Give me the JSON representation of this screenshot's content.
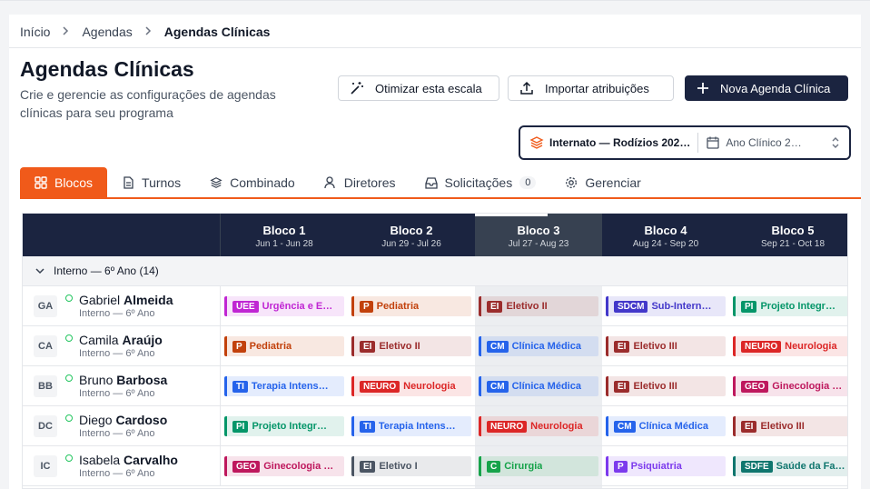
{
  "breadcrumb": [
    "Início",
    "Agendas",
    "Agendas Clínicas"
  ],
  "page": {
    "title": "Agendas Clínicas",
    "subtitle": "Crie e gerencie as configurações de agendas clínicas para seu programa"
  },
  "actions": {
    "optimize": "Otimizar esta escala",
    "import": "Importar atribuições",
    "new": "Nova Agenda Clínica"
  },
  "selector": {
    "program": "Internato — Rodízios 202…",
    "year": "Ano Clínico 2…"
  },
  "tabs": [
    {
      "label": "Blocos",
      "active": true,
      "icon": "blocks-icon"
    },
    {
      "label": "Turnos",
      "icon": "document-icon"
    },
    {
      "label": "Combinado",
      "icon": "layers-icon"
    },
    {
      "label": "Diretores",
      "icon": "user-icon"
    },
    {
      "label": "Solicitações",
      "badge": "0",
      "icon": "inbox-icon"
    },
    {
      "label": "Gerenciar",
      "icon": "gear-icon"
    }
  ],
  "blocos": [
    {
      "name": "Bloco 1",
      "dates": "Jun 1 - Jun 28"
    },
    {
      "name": "Bloco 2",
      "dates": "Jun 29 - Jul 26"
    },
    {
      "name": "Bloco 3",
      "dates": "Jul 27 - Aug 23",
      "current": true
    },
    {
      "name": "Bloco 4",
      "dates": "Aug 24 - Sep 20"
    },
    {
      "name": "Bloco 5",
      "dates": "Sep 21 - Oct 18"
    }
  ],
  "group": {
    "label": "Interno — 6º Ano (14)"
  },
  "colors": {
    "UEE": "#c026d3",
    "P": "#c2410c",
    "EI": "#9b2c2c",
    "SDCM": "#4338ca",
    "PI": "#059669",
    "CM": "#2563eb",
    "TI": "#2563eb",
    "NEURO": "#dc2626",
    "GEO": "#be185d",
    "C": "#16a34a",
    "SDFE": "#0f766e"
  },
  "rows": [
    {
      "initials": "GA",
      "first": "Gabriel",
      "last": "Almeida",
      "role": "Interno — 6º Ano",
      "cells": [
        {
          "code": "UEE",
          "label": "Urgência e E…"
        },
        {
          "code": "P",
          "label": "Pediatria"
        },
        {
          "code": "EI",
          "label": "Eletivo II"
        },
        {
          "code": "SDCM",
          "label": "Sub-Intern…"
        },
        {
          "code": "PI",
          "label": "Projeto Integr…"
        }
      ]
    },
    {
      "initials": "CA",
      "first": "Camila",
      "last": "Araújo",
      "role": "Interno — 6º Ano",
      "cells": [
        {
          "code": "P",
          "label": "Pediatria"
        },
        {
          "code": "EI",
          "label": "Eletivo II"
        },
        {
          "code": "CM",
          "label": "Clínica Médica"
        },
        {
          "code": "EI",
          "label": "Eletivo III"
        },
        {
          "code": "NEURO",
          "label": "Neurologia"
        }
      ]
    },
    {
      "initials": "BB",
      "first": "Bruno",
      "last": "Barbosa",
      "role": "Interno — 6º Ano",
      "cells": [
        {
          "code": "TI",
          "label": "Terapia Intens…"
        },
        {
          "code": "NEURO",
          "label": "Neurologia"
        },
        {
          "code": "CM",
          "label": "Clínica Médica"
        },
        {
          "code": "EI",
          "label": "Eletivo III"
        },
        {
          "code": "GEO",
          "label": "Ginecologia …"
        }
      ]
    },
    {
      "initials": "DC",
      "first": "Diego",
      "last": "Cardoso",
      "role": "Interno — 6º Ano",
      "cells": [
        {
          "code": "PI",
          "label": "Projeto Integr…"
        },
        {
          "code": "TI",
          "label": "Terapia Intens…"
        },
        {
          "code": "NEURO",
          "label": "Neurologia"
        },
        {
          "code": "CM",
          "label": "Clínica Médica"
        },
        {
          "code": "EI",
          "label": "Eletivo III"
        }
      ]
    },
    {
      "initials": "IC",
      "first": "Isabela",
      "last": "Carvalho",
      "role": "Interno — 6º Ano",
      "cells": [
        {
          "code": "GEO",
          "label": "Ginecologia …"
        },
        {
          "code": "EI",
          "label": "Eletivo I",
          "color": "#4b5563"
        },
        {
          "code": "C",
          "label": "Cirurgia"
        },
        {
          "code": "P",
          "label": "Psiquiatria",
          "color": "#7c3aed"
        },
        {
          "code": "SDFE",
          "label": "Saúde da Fa…"
        }
      ]
    }
  ]
}
